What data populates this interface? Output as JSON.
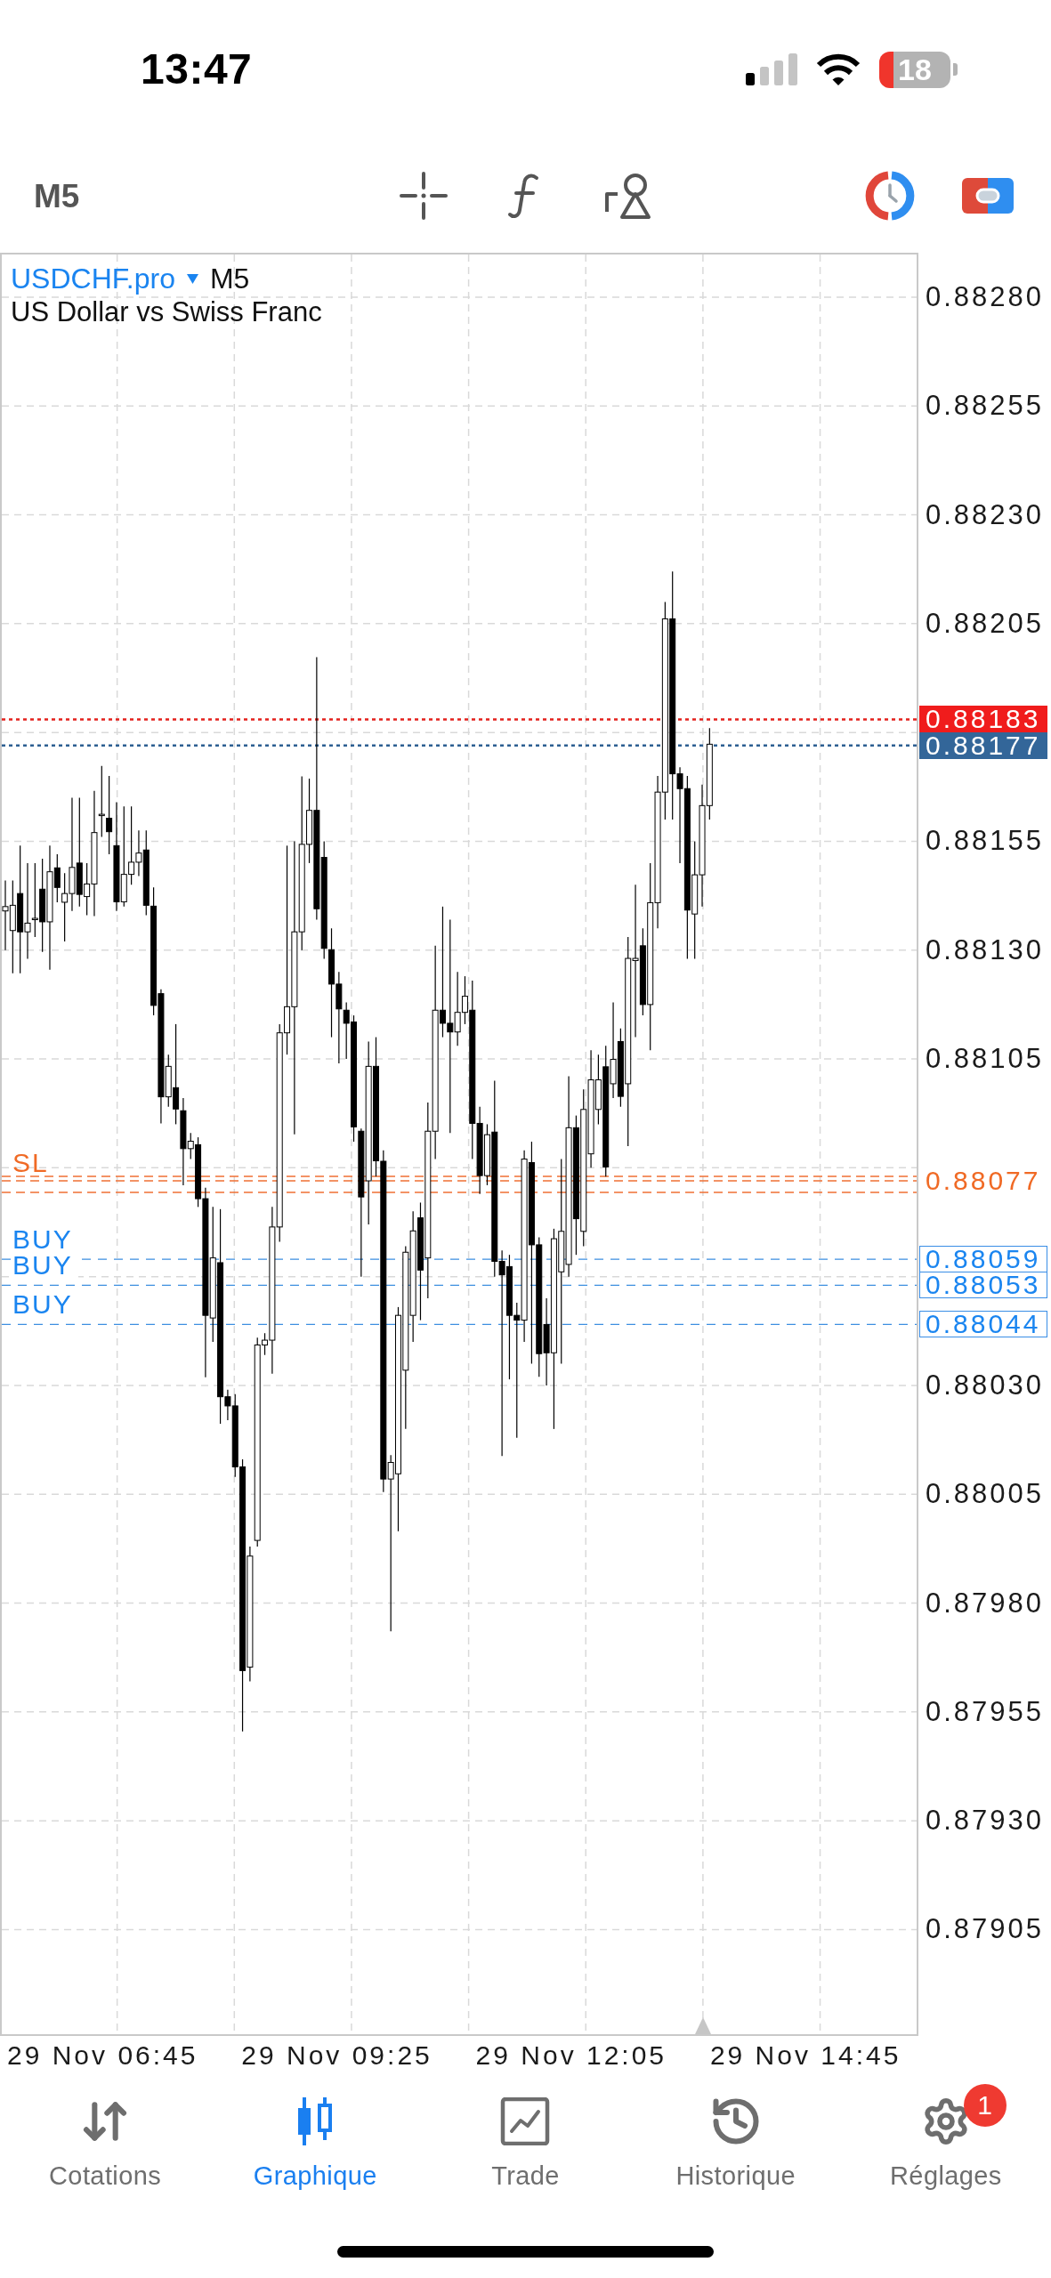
{
  "status_bar": {
    "time": "13:47",
    "battery": "18"
  },
  "toolbar": {
    "timeframe": "M5"
  },
  "chart": {
    "symbol": "USDCHF.pro",
    "timeframe": "M5",
    "description": "US Dollar vs Swiss Franc",
    "price_axis": [
      "0.88280",
      "0.88255",
      "0.88230",
      "0.88205",
      "0.88155",
      "0.88130",
      "0.88105",
      "0.88030",
      "0.88005",
      "0.87980",
      "0.87955",
      "0.87930",
      "0.87905"
    ],
    "price_lines": [
      {
        "kind": "ask",
        "price": "0.88183"
      },
      {
        "kind": "bid",
        "price": "0.88177"
      },
      {
        "kind": "stop_loss",
        "label": "SL",
        "price": "0.88077"
      },
      {
        "kind": "buy",
        "label": "BUY",
        "price": "0.88059"
      },
      {
        "kind": "buy",
        "label": "BUY",
        "price": "0.88053"
      },
      {
        "kind": "buy",
        "label": "BUY",
        "price": "0.88044"
      }
    ],
    "time_axis": [
      "29 Nov 06:45",
      "29 Nov 09:25",
      "29 Nov 12:05",
      "29 Nov 14:45"
    ]
  },
  "tabs": [
    {
      "label": "Cotations",
      "selected": false
    },
    {
      "label": "Graphique",
      "selected": true
    },
    {
      "label": "Trade",
      "selected": false
    },
    {
      "label": "Historique",
      "selected": false
    },
    {
      "label": "Réglages",
      "selected": false,
      "badge": "1"
    }
  ]
}
